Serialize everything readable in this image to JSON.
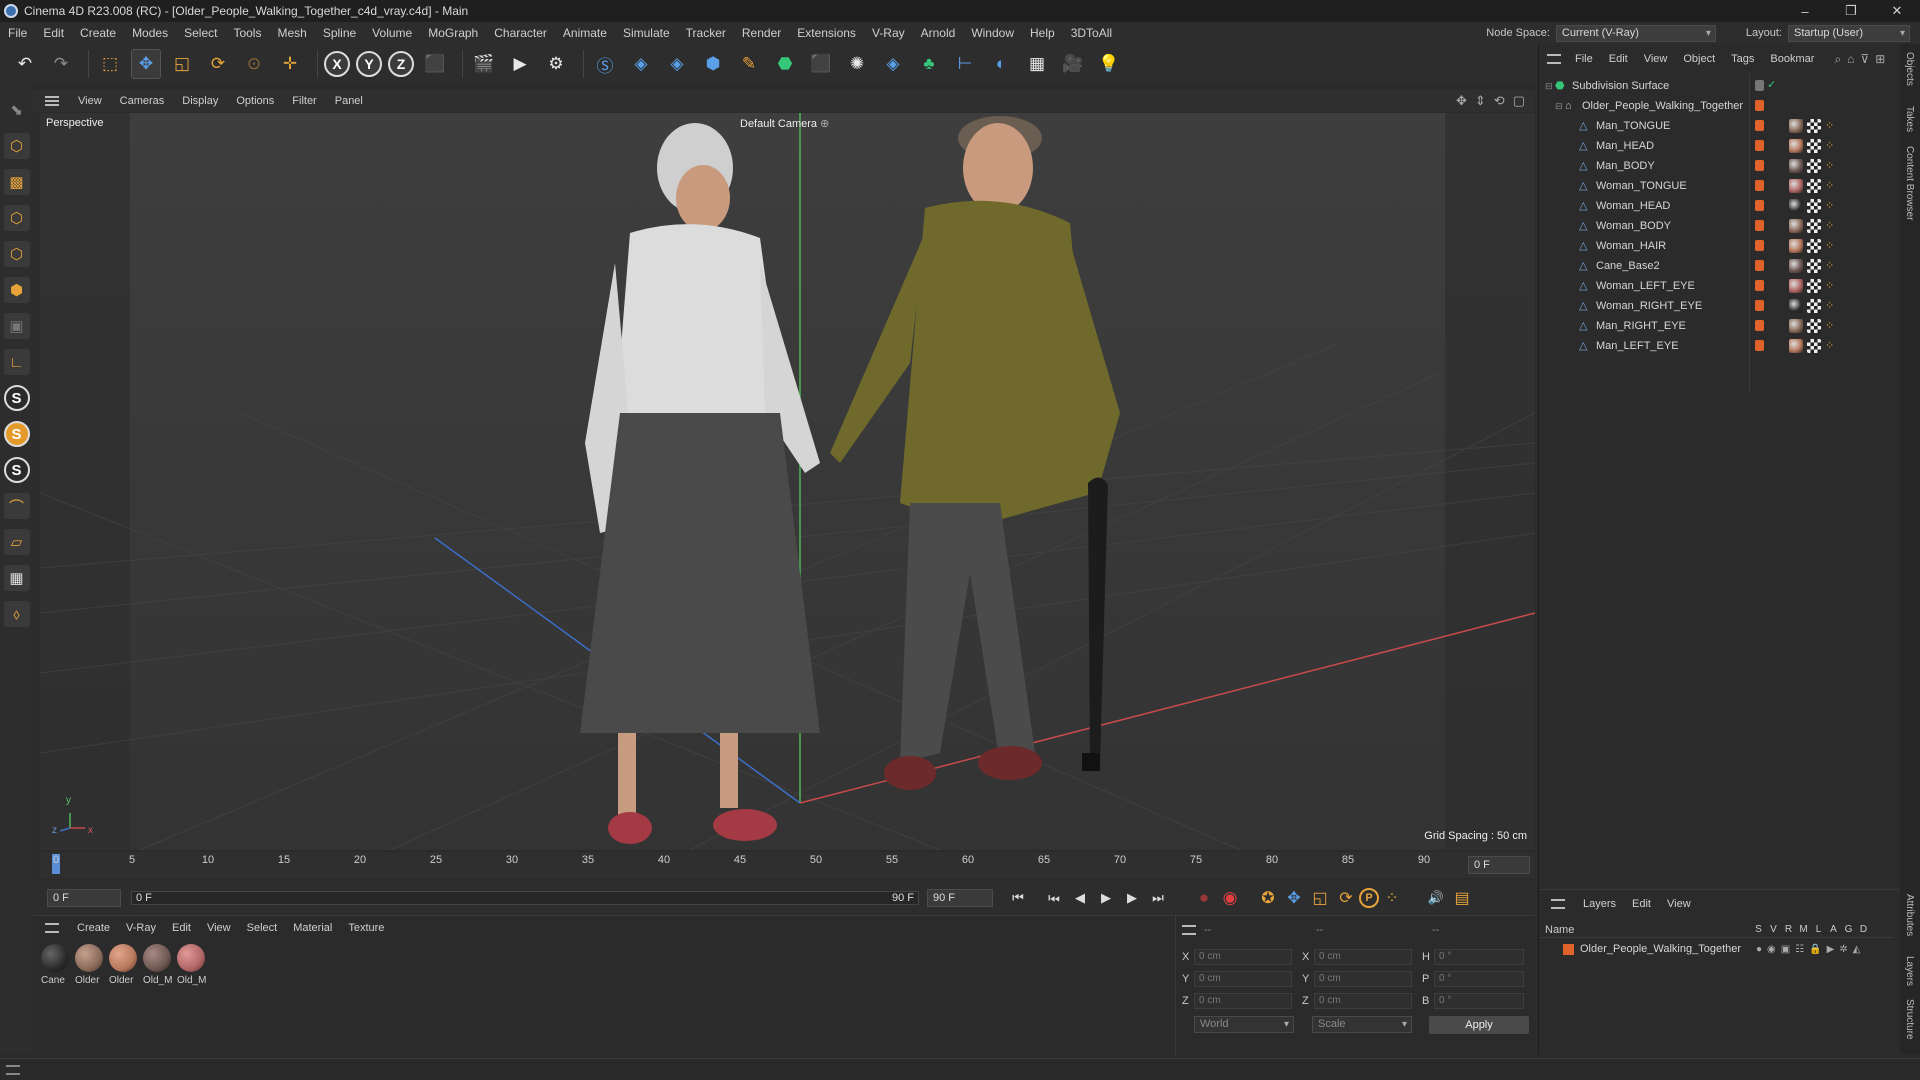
{
  "window": {
    "title": "Cinema 4D R23.008 (RC) - [Older_People_Walking_Together_c4d_vray.c4d] - Main",
    "minimize": "–",
    "restore": "❐",
    "close": "✕"
  },
  "menubar": {
    "items": [
      "File",
      "Edit",
      "Create",
      "Modes",
      "Select",
      "Tools",
      "Mesh",
      "Spline",
      "Volume",
      "MoGraph",
      "Character",
      "Animate",
      "Simulate",
      "Tracker",
      "Render",
      "Extensions",
      "V-Ray",
      "Arnold",
      "Window",
      "Help",
      "3DToAll"
    ],
    "node_space_label": "Node Space:",
    "node_space_value": "Current (V-Ray)",
    "layout_label": "Layout:",
    "layout_value": "Startup (User)"
  },
  "toolbar": {
    "axis_x": "X",
    "axis_y": "Y",
    "axis_z": "Z"
  },
  "lefttools": {
    "s1": "S",
    "s2": "S",
    "s3": "S"
  },
  "viewport": {
    "menu": [
      "View",
      "Cameras",
      "Display",
      "Options",
      "Filter",
      "Panel"
    ],
    "label": "Perspective",
    "camera": "Default Camera",
    "grid_spacing": "Grid Spacing : 50 cm",
    "axis_y": "y",
    "axis_z": "z",
    "axis_x": "x"
  },
  "timeline": {
    "ticks": [
      "0",
      "5",
      "10",
      "15",
      "20",
      "25",
      "30",
      "35",
      "40",
      "45",
      "50",
      "55",
      "60",
      "65",
      "70",
      "75",
      "80",
      "85",
      "90"
    ],
    "current_frame": "0 F"
  },
  "transport": {
    "start_field": "0 F",
    "range_start": "0 F",
    "range_end": "90 F",
    "end_field": "90 F",
    "go_start": "⏮",
    "prev_key": "⏭",
    "prev_frame": "◀",
    "play": "▶",
    "next_frame": "▶",
    "go_end": "⏭",
    "p_label": "P"
  },
  "materials": {
    "menu": [
      "Create",
      "V-Ray",
      "Edit",
      "View",
      "Select",
      "Material",
      "Texture"
    ],
    "items": [
      {
        "name": "Cane",
        "color": "#2a2a2a"
      },
      {
        "name": "Older",
        "color": "#8a6a5a"
      },
      {
        "name": "Older",
        "color": "#b7775c"
      },
      {
        "name": "Old_M",
        "color": "#6e5752"
      },
      {
        "name": "Old_M",
        "color": "#b06664"
      }
    ]
  },
  "coordinates": {
    "header_dash1": "--",
    "header_dash2": "--",
    "header_dash3": "--",
    "rows": [
      {
        "a1": "X",
        "v1": "0 cm",
        "a2": "X",
        "v2": "0 cm",
        "a3": "H",
        "v3": "0 °"
      },
      {
        "a1": "Y",
        "v1": "0 cm",
        "a2": "Y",
        "v2": "0 cm",
        "a3": "P",
        "v3": "0 °"
      },
      {
        "a1": "Z",
        "v1": "0 cm",
        "a2": "Z",
        "v2": "0 cm",
        "a3": "B",
        "v3": "0 °"
      }
    ],
    "space": "World",
    "mode": "Scale",
    "apply": "Apply"
  },
  "objects": {
    "menu": [
      "File",
      "Edit",
      "View",
      "Object",
      "Tags",
      "Bookmar"
    ],
    "root": "Subdivision Surface",
    "group": "Older_People_Walking_Together",
    "children": [
      "Man_TONGUE",
      "Man_HEAD",
      "Man_BODY",
      "Woman_TONGUE",
      "Woman_HEAD",
      "Woman_BODY",
      "Woman_HAIR",
      "Cane_Base2",
      "Woman_LEFT_EYE",
      "Woman_RIGHT_EYE",
      "Man_RIGHT_EYE",
      "Man_LEFT_EYE"
    ]
  },
  "layers": {
    "menu": [
      "Layers",
      "Edit",
      "View"
    ],
    "name_header": "Name",
    "cols": [
      "S",
      "V",
      "R",
      "M",
      "L",
      "A",
      "G",
      "D"
    ],
    "row_name": "Older_People_Walking_Together"
  },
  "sidetabs": [
    "Objects",
    "Takes",
    "Content Browser",
    "Attributes",
    "Layers",
    "Structure"
  ]
}
